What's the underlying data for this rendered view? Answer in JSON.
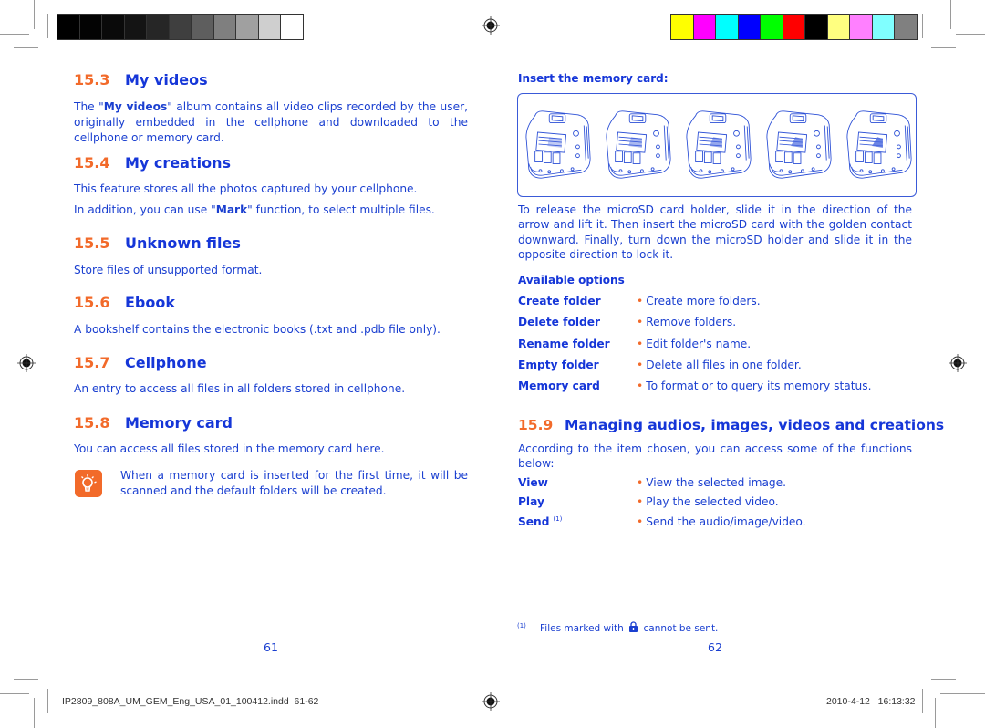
{
  "print_marks": {
    "grayscale_swatches": [
      "#000000",
      "#030303",
      "#0a0a0a",
      "#141414",
      "#262626",
      "#3f3f3f",
      "#5e5e5e",
      "#7f7f7f",
      "#a0a0a0",
      "#cfcfcf",
      "#ffffff"
    ],
    "color_swatches": [
      "#ffff00",
      "#ff00ff",
      "#00ffff",
      "#0000ff",
      "#00ff00",
      "#ff0000",
      "#000000",
      "#ffff80",
      "#ff80ff",
      "#80ffff",
      "#808080"
    ]
  },
  "colors": {
    "heading_number": "#f26a2a",
    "heading_text": "#1536d8",
    "body_text": "#1a3fd0"
  },
  "left_page": {
    "sections": [
      {
        "number": "15.3",
        "title": "My videos"
      },
      {
        "number": "15.4",
        "title": "My creations"
      },
      {
        "number": "15.5",
        "title": "Unknown files"
      },
      {
        "number": "15.6",
        "title": "Ebook"
      },
      {
        "number": "15.7",
        "title": "Cellphone"
      },
      {
        "number": "15.8",
        "title": "Memory card"
      }
    ],
    "my_videos_text": {
      "pre": "The \"",
      "bold": "My videos",
      "post": "\" album contains all video clips recorded by the user, originally embedded in the cellphone and downloaded to the cellphone or memory card."
    },
    "my_creations_text_1": "This feature stores all the photos captured by your cellphone.",
    "my_creations_text_2": {
      "pre": "In addition, you can use \"",
      "bold": "Mark",
      "post": "\" function, to select multiple files."
    },
    "unknown_files_text": "Store files of unsupported format.",
    "ebook_text": "A bookshelf contains the electronic books (.txt and .pdb file only).",
    "cellphone_text": "An entry to access all files in all folders stored in cellphone.",
    "memory_card_text": "You can access all files stored in the memory card here.",
    "tip_icon": "lightbulb-tip-icon",
    "tip_text": "When a memory card is inserted for the first time, it will be scanned and the default folders will be created.",
    "page_number": "61"
  },
  "right_page": {
    "insert_heading": "Insert the memory card:",
    "figure_steps": 5,
    "insert_text": "To release the microSD card holder, slide it in the direction of the arrow and lift it. Then insert the microSD card with the golden contact downward. Finally, turn down the microSD holder and slide it in the opposite direction to lock it.",
    "available_options_heading": "Available options",
    "options": [
      {
        "label": "Create folder",
        "desc": "Create more folders."
      },
      {
        "label": "Delete folder",
        "desc": "Remove folders."
      },
      {
        "label": "Rename folder",
        "desc": "Edit folder's name."
      },
      {
        "label": "Empty folder",
        "desc": "Delete all files in one folder."
      },
      {
        "label": "Memory card",
        "desc": "To format or to query its memory status."
      }
    ],
    "section": {
      "number": "15.9",
      "title": "Managing audios, images, videos and creations"
    },
    "section_text": "According to the item chosen, you can access some of the functions below:",
    "functions": [
      {
        "label": "View",
        "desc": "View the selected image.",
        "note": ""
      },
      {
        "label": "Play",
        "desc": "Play the selected video.",
        "note": ""
      },
      {
        "label": "Send",
        "desc": "Send the audio/image/video.",
        "note": "(1)"
      }
    ],
    "footnote_marker": "(1)",
    "footnote_pre": "Files marked with",
    "footnote_icon": "lock-icon",
    "footnote_post": "cannot be sent.",
    "page_number": "62"
  },
  "slug": {
    "filename": "IP2809_808A_UM_GEM_Eng_USA_01_100412.indd",
    "pages": "61-62",
    "date": "2010-4-12",
    "time": "16:13:32"
  }
}
